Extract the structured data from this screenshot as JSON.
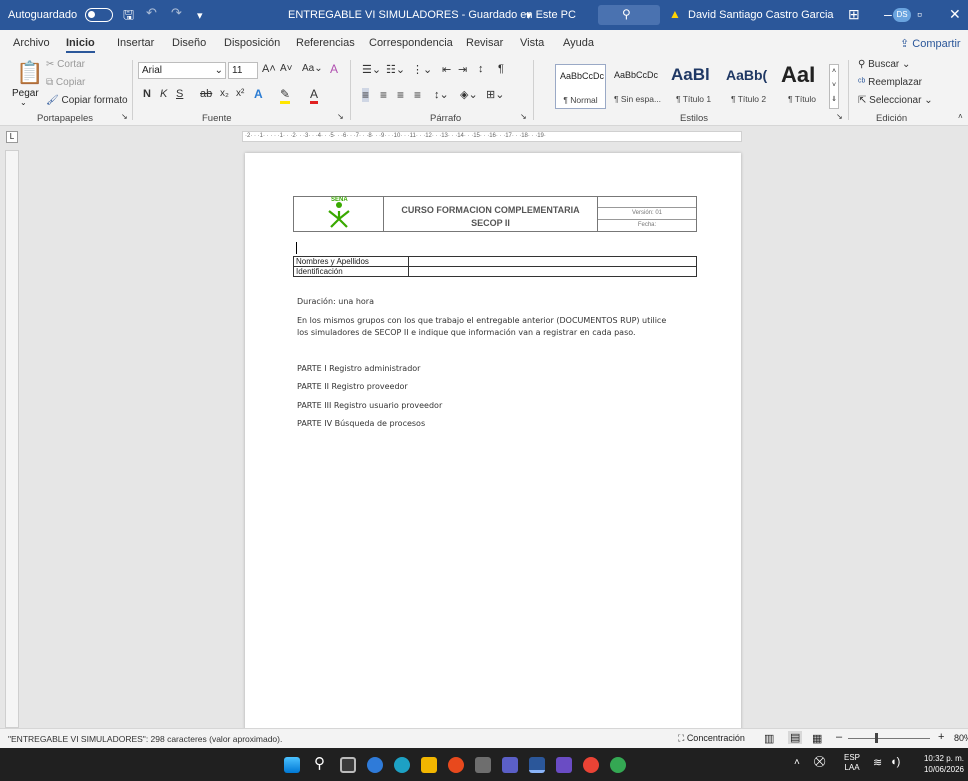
{
  "titlebar": {
    "autosave_label": "Autoguardado",
    "document_title": "ENTREGABLE VI SIMULADORES - Guardado en Este PC",
    "user_name": "David Santiago Castro Garcia",
    "user_initials": "DS"
  },
  "tabs": [
    "Archivo",
    "Inicio",
    "Insertar",
    "Diseño",
    "Disposición",
    "Referencias",
    "Correspondencia",
    "Revisar",
    "Vista",
    "Ayuda"
  ],
  "share_label": "Compartir",
  "ribbon": {
    "clipboard": {
      "paste": "Pegar",
      "cut": "Cortar",
      "copy": "Copiar",
      "format_painter": "Copiar formato",
      "label": "Portapapeles"
    },
    "font": {
      "name": "Arial",
      "size": "11",
      "label": "Fuente",
      "bold": "N",
      "italic": "K",
      "underline": "S"
    },
    "paragraph": {
      "label": "Párrafo"
    },
    "styles": {
      "label": "Estilos",
      "items": [
        {
          "sample": "AaBbCcDc",
          "name": "¶ Normal"
        },
        {
          "sample": "AaBbCcDc",
          "name": "¶ Sin espa..."
        },
        {
          "sample": "AaBl",
          "name": "¶ Título 1"
        },
        {
          "sample": "AaBb(",
          "name": "¶ Título 2"
        },
        {
          "sample": "AaI",
          "name": "¶ Título"
        }
      ]
    },
    "editing": {
      "find": "Buscar",
      "replace": "Reemplazar",
      "select": "Seleccionar",
      "label": "Edición"
    }
  },
  "ruler_text": "·2· · ·1· · · · ·1· · ·2· · ·3· · ·4· · ·5· · ·6· · ·7· · ·8· · ·9· · ·10· · ·11· · ·12· · ·13· · ·14· · ·15· · ·16· · ·17· · ·18· · ·19·",
  "document": {
    "header": {
      "logo_text": "SENA",
      "title_line1": "CURSO FORMACION COMPLEMENTARIA",
      "title_line2": "SECOP II",
      "version": "Versión: 01",
      "date": "Fecha:"
    },
    "table": [
      {
        "label": "Nombres y Apellidos",
        "value": ""
      },
      {
        "label": "Identificación",
        "value": ""
      }
    ],
    "duration": "Duración: una hora",
    "instructions_line1": "En los mismos grupos con los que trabajo el entregable anterior (DOCUMENTOS RUP) utilice",
    "instructions_line2": "los simuladores de SECOP II e indique que información van a registrar en cada paso.",
    "parts": [
      "PARTE I Registro administrador",
      "PARTE II Registro proveedor",
      "PARTE III Registro usuario proveedor",
      "PARTE IV Búsqueda de procesos"
    ]
  },
  "status": {
    "word_count": "\"ENTREGABLE VI SIMULADORES\": 298 caracteres (valor aproximado).",
    "focus": "Concentración",
    "zoom": "80%"
  },
  "taskbar": {
    "lang1": "ESP",
    "lang2": "LAA",
    "time": "10:32 p. m.",
    "date": "10/06/2026"
  },
  "colors": {
    "word_blue": "#2b579a",
    "sena_green": "#39a900"
  }
}
